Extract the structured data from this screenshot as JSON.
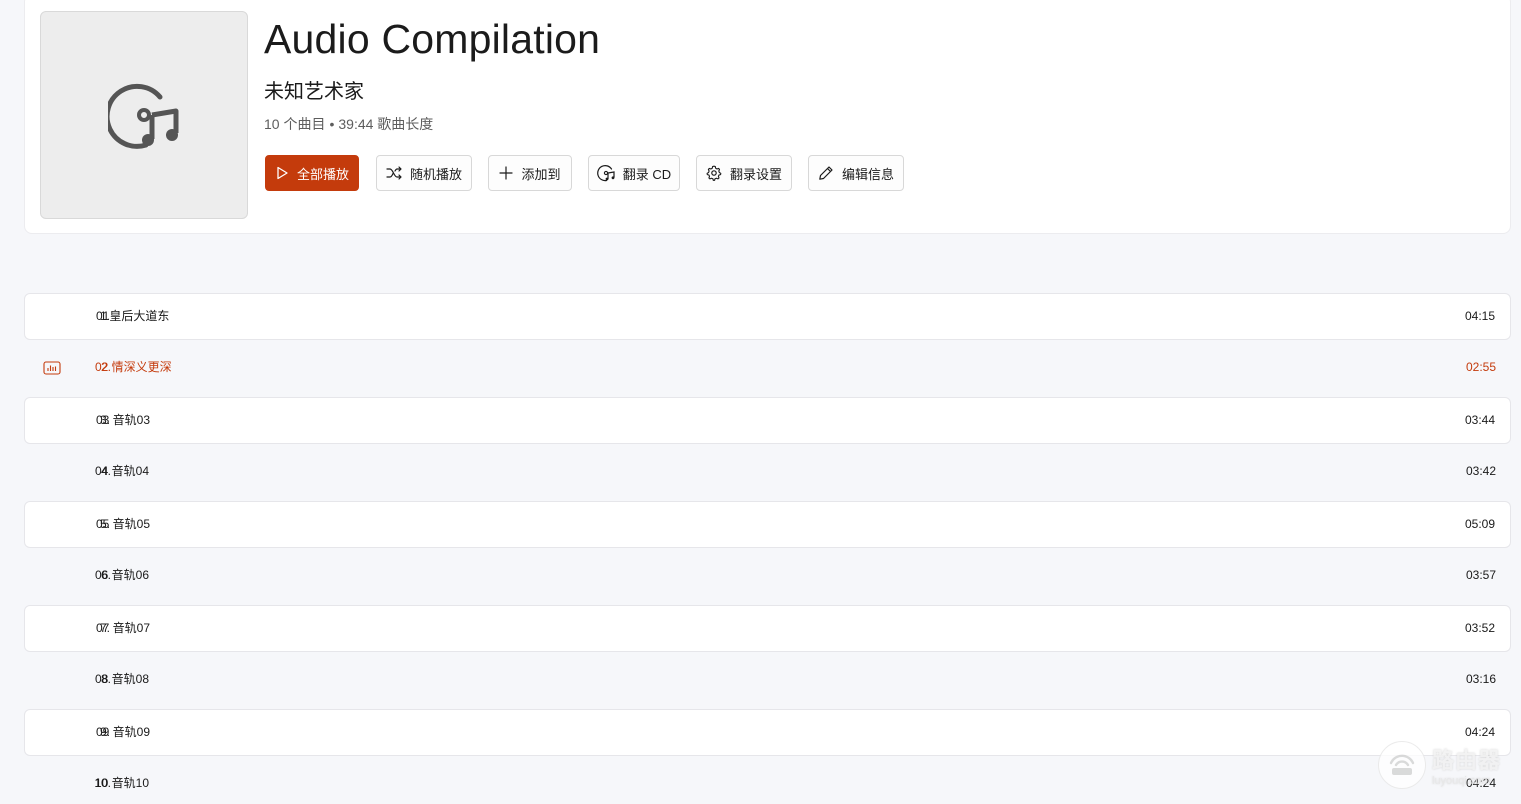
{
  "album": {
    "title": "Audio Compilation",
    "artist": "未知艺术家",
    "track_count": "10 个曲目",
    "separator": "•",
    "duration": "39:44 歌曲长度"
  },
  "actions": {
    "play_all": "全部播放",
    "shuffle": "随机播放",
    "add_to": "添加到",
    "rip_cd": "翻录 CD",
    "rip_settings": "翻录设置",
    "edit_info": "编辑信息"
  },
  "tracks": [
    {
      "num": "1.",
      "title": "01皇后大道东",
      "duration": "04:15"
    },
    {
      "num": "2.",
      "title": "02 情深义更深",
      "duration": "02:55"
    },
    {
      "num": "3.",
      "title": "03 音轨03",
      "duration": "03:44"
    },
    {
      "num": "4.",
      "title": "04 音轨04",
      "duration": "03:42"
    },
    {
      "num": "5.",
      "title": "05 音轨05",
      "duration": "05:09"
    },
    {
      "num": "6.",
      "title": "06 音轨06",
      "duration": "03:57"
    },
    {
      "num": "7.",
      "title": "07 音轨07",
      "duration": "03:52"
    },
    {
      "num": "8.",
      "title": "08 音轨08",
      "duration": "03:16"
    },
    {
      "num": "9.",
      "title": "09 音轨09",
      "duration": "04:24"
    },
    {
      "num": "10.",
      "title": "10 音轨10",
      "duration": "04:24"
    }
  ],
  "watermark": {
    "main": "路由器",
    "sub": "luyouqi.com"
  },
  "colors": {
    "accent": "#c43b0c",
    "background": "#f6f7fa",
    "card": "#ffffff"
  }
}
